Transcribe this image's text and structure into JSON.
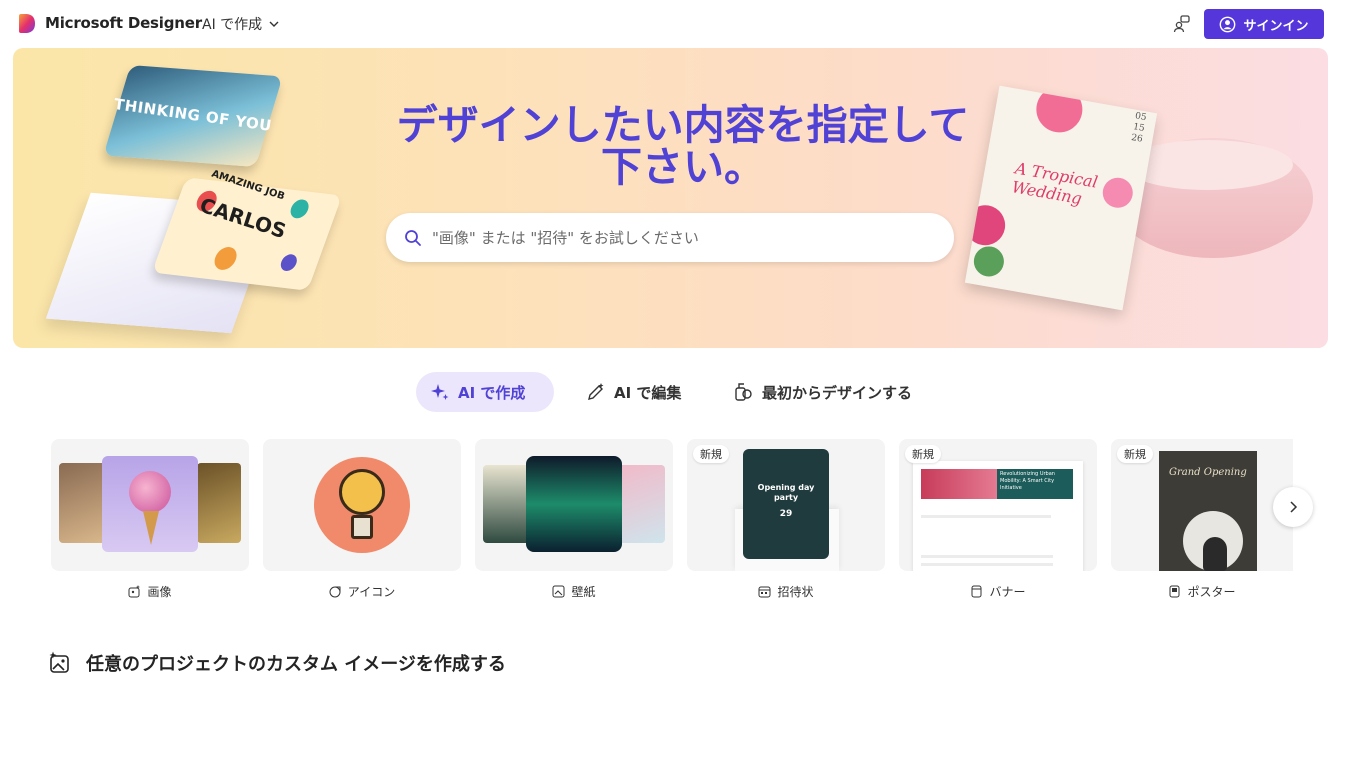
{
  "header": {
    "brand": "Microsoft Designer",
    "menu_label": "AI で作成",
    "signin_label": "サインイン"
  },
  "hero": {
    "title": "デザインしたい内容を指定して下さい。",
    "search_placeholder": "\"画像\" または \"招待\" をお試しください",
    "art_left_top": "THINKING OF YOU",
    "art_left_sub": "AMAZING JOB",
    "art_left_name": "CARLOS",
    "art_right_title": "A Tropical Wedding",
    "art_right_date": "05\n15\n26"
  },
  "tabs": [
    {
      "label": "AI で作成",
      "icon": "sparkle-icon",
      "active": true
    },
    {
      "label": "AI で編集",
      "icon": "edit-sparkle-icon",
      "active": false
    },
    {
      "label": "最初からデザインする",
      "icon": "design-shapes-icon",
      "active": false
    }
  ],
  "categories": [
    {
      "label": "画像",
      "icon": "image-sparkle-icon",
      "badge": ""
    },
    {
      "label": "アイコン",
      "icon": "icon-sticker-icon",
      "badge": ""
    },
    {
      "label": "壁紙",
      "icon": "wallpaper-icon",
      "badge": ""
    },
    {
      "label": "招待状",
      "icon": "calendar-icon",
      "badge": "新規",
      "thumb_text": "Opening day party",
      "thumb_num": "29"
    },
    {
      "label": "バナー",
      "icon": "banner-icon",
      "badge": "新規",
      "thumb_text": "Revolutionizing Urban Mobility: A Smart City Initiative"
    },
    {
      "label": "ポスター",
      "icon": "poster-icon",
      "badge": "新規",
      "thumb_text": "Grand Opening"
    }
  ],
  "section": {
    "title": "任意のプロジェクトのカスタム イメージを作成する"
  },
  "colors": {
    "accent": "#5436da",
    "hero_title": "#5142d6",
    "tab_active_bg": "#ebe6fb"
  }
}
